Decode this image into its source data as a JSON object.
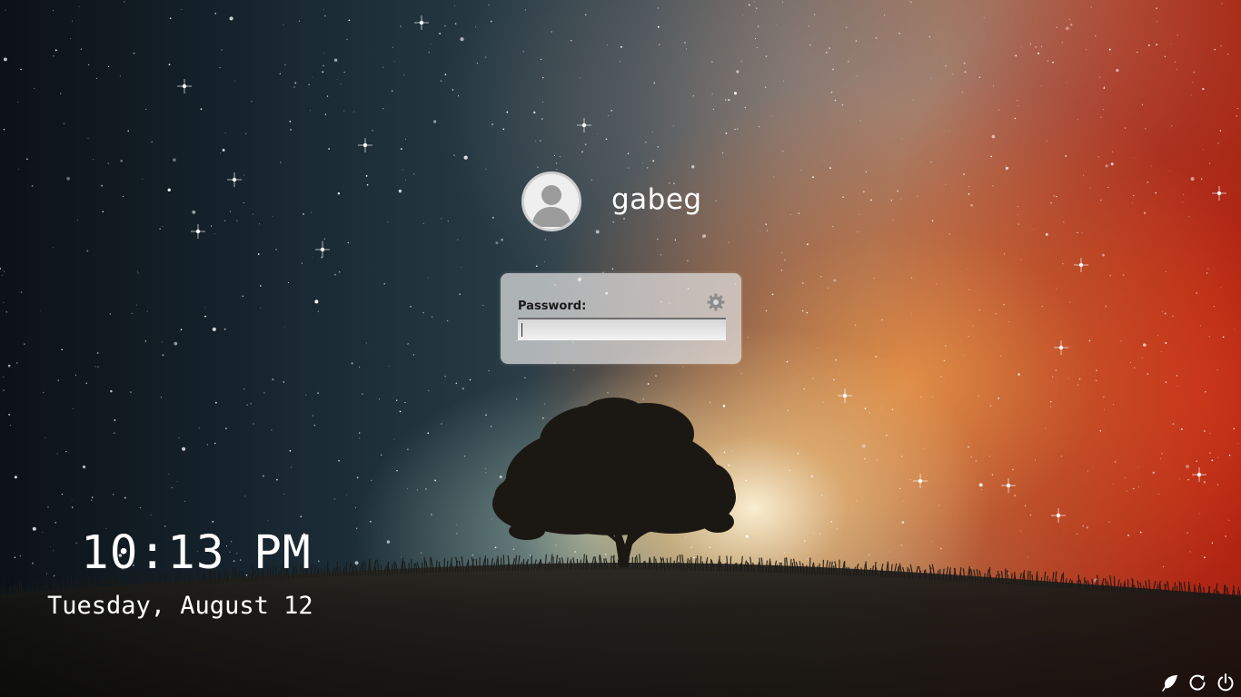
{
  "user": {
    "name": "gabeg",
    "avatar_icon": "default-user-avatar-icon"
  },
  "login": {
    "password_label": "Password:",
    "password_value": "",
    "session_icon": "gear-icon"
  },
  "clock": {
    "time": "10:13 PM",
    "date": "Tuesday, August 12"
  },
  "system_buttons": [
    {
      "name": "suspend",
      "icon": "leaf-icon"
    },
    {
      "name": "restart",
      "icon": "restart-icon"
    },
    {
      "name": "shutdown",
      "icon": "power-icon"
    }
  ],
  "colors": {
    "text": "#ffffff",
    "login_box": "#e1e1e1",
    "label": "#1a1a1a"
  }
}
